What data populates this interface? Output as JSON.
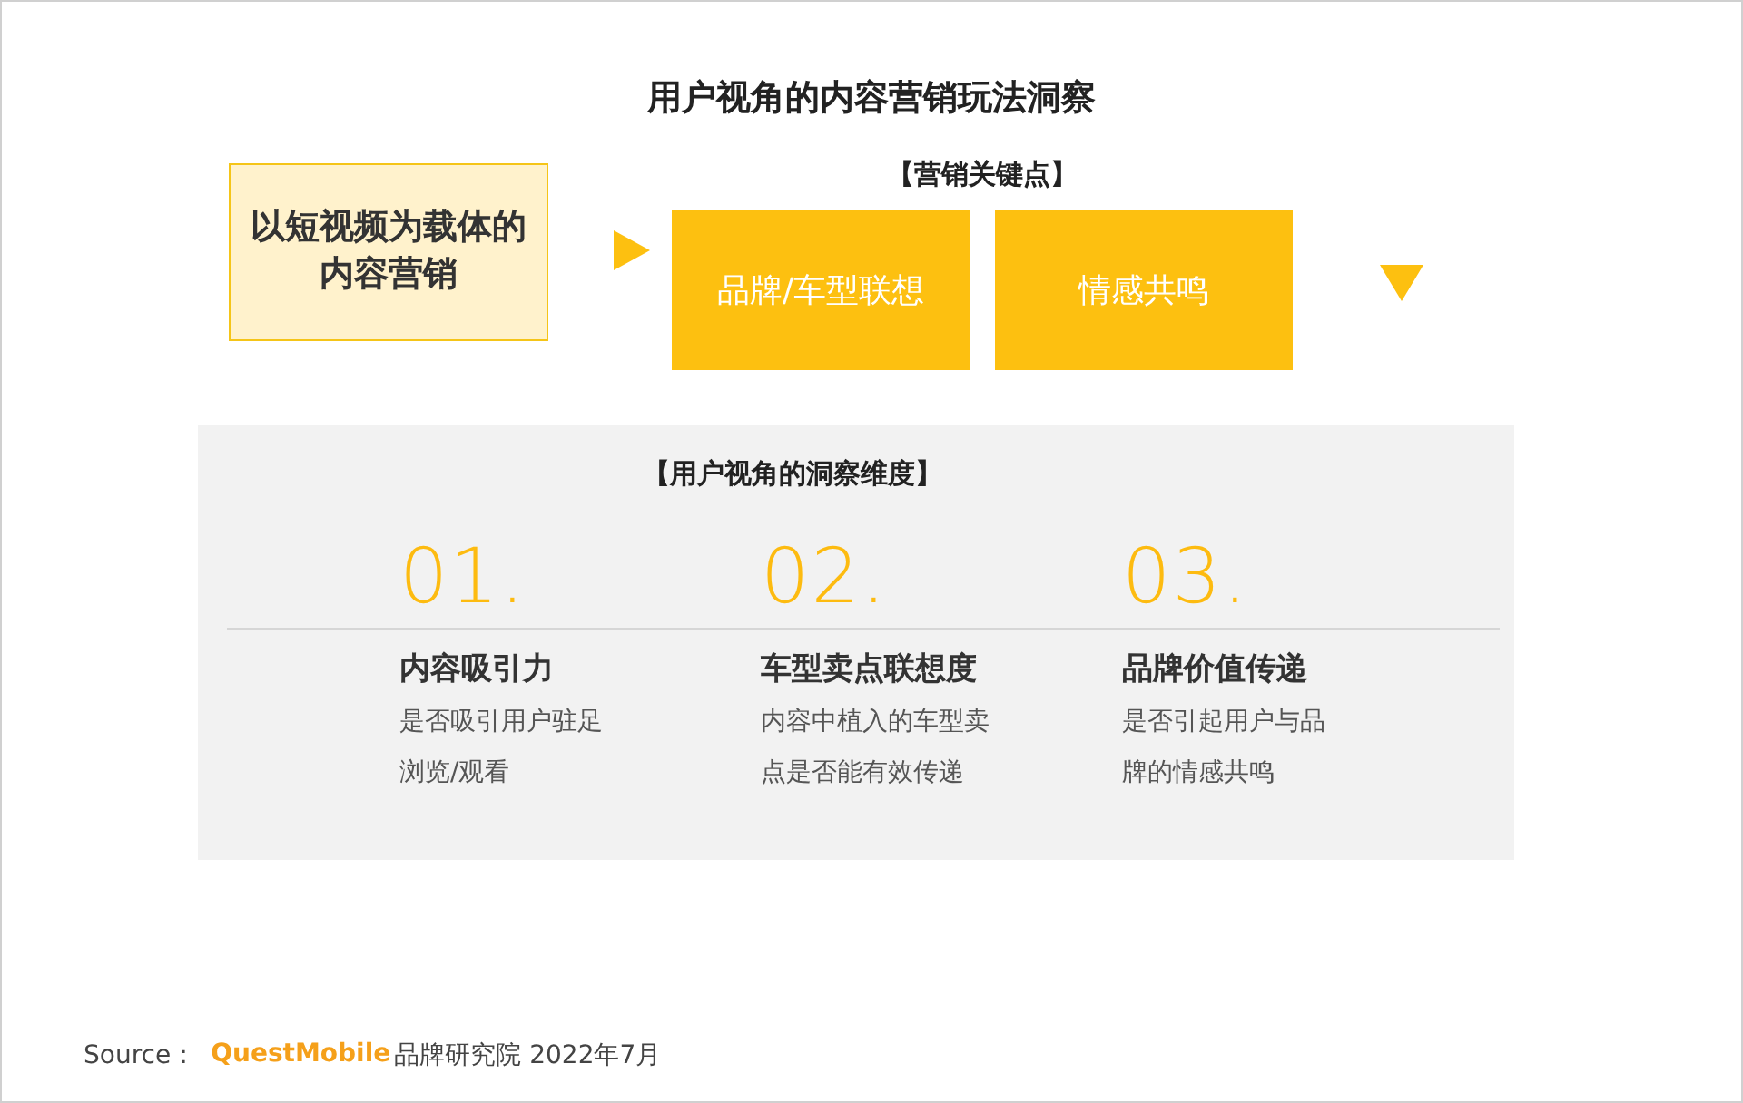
{
  "title": "用户视角的内容营销玩法洞察",
  "carrier": {
    "text": "以短视频为载体的内容营销"
  },
  "key_points": {
    "heading": "【营销关键点】",
    "items": [
      "品牌/车型联想",
      "情感共鸣"
    ]
  },
  "insights": {
    "heading": "【用户视角的洞察维度】",
    "items": [
      {
        "number": "01.",
        "title": "内容吸引力",
        "lines": [
          "是否吸引用户驻足",
          "浏览/观看"
        ]
      },
      {
        "number": "02.",
        "title": "车型卖点联想度",
        "lines": [
          "内容中植入的车型卖",
          "点是否能有效传递"
        ]
      },
      {
        "number": "03.",
        "title": "品牌价值传递",
        "lines": [
          "是否引起用户与品",
          "牌的情感共鸣"
        ]
      }
    ]
  },
  "source": {
    "label": "Source：",
    "brand": "QuestMobile",
    "rest": "品牌研究院 2022年7月"
  }
}
